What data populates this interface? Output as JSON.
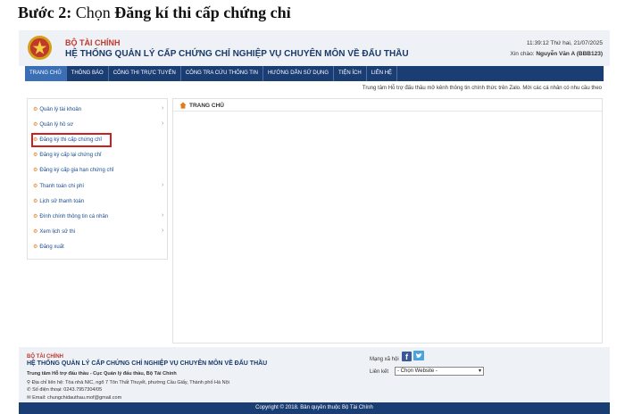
{
  "step": {
    "prefix": "Bước 2:",
    "middle": " Chọn ",
    "bold": "Đăng kí thi cấp chứng chỉ"
  },
  "header": {
    "org": "BỘ TÀI CHÍNH",
    "title": "HỆ THỐNG QUẢN LÝ CẤP CHỨNG CHỈ NGHIỆP VỤ CHUYÊN MÔN VỀ ĐẤU THẦU",
    "datetime": "11:39:12 Thứ hai, 21/07/2025",
    "greeting_prefix": "Xin chào: ",
    "user": "Nguyễn Văn A (BBB123)"
  },
  "nav": [
    "TRANG CHỦ",
    "THÔNG BÁO",
    "CÔNG THI TRỰC TUYẾN",
    "CÔNG TRA CỨU THÔNG TIN",
    "HƯỚNG DẪN SỬ DỤNG",
    "TIỆN ÍCH",
    "LIÊN HỆ"
  ],
  "marquee": "Trung tâm Hỗ trợ đấu thầu mở kênh thông tin chính thức trên Zalo. Mời các cá nhân có nhu cầu theo",
  "sidebar": {
    "items": [
      "Quản lý tài khoản",
      "Quản lý hồ sơ",
      "Đăng ký thi cấp chứng chỉ",
      "Đăng ký cấp lại chứng chỉ",
      "Đăng ký cấp gia hạn chứng chỉ",
      "Thanh toán chi phí",
      "Lịch sử thanh toán",
      "Đính chính thông tin cá nhân",
      "Xem lịch sử thi",
      "Đăng xuất"
    ],
    "chevron": "›",
    "bullet": "⚙"
  },
  "main": {
    "title": "TRANG CHỦ"
  },
  "footer": {
    "org": "BỘ TÀI CHÍNH",
    "title": "HỆ THỐNG QUẢN LÝ CẤP CHỨNG CHỈ NGHIỆP VỤ CHUYÊN MÔN VỀ ĐẤU THẦU",
    "center": "Trung tâm Hỗ trợ đấu thầu - Cục Quản lý đấu thầu, Bộ Tài Chính",
    "address": "Địa chỉ liên hệ: Tòa nhà NIC, ngõ 7 Tôn Thất Thuyết, phường Cầu Giấy, Thành phố Hà Nội",
    "phone": "Số điện thoại: 0243.7957304/05",
    "email": "Email: chungchidauthau.mof@gmail.com",
    "social_label": "Mạng xã hội",
    "fb_glyph": "f",
    "link_label": "Liên kết",
    "website_select": "- Chọn Website -",
    "copyright": "Copyright © 2018. Bản quyền thuộc Bộ Tài Chính"
  },
  "colors": {
    "nav_bg": "#1a3d73",
    "nav_active": "#3a6fb5",
    "highlight": "#cc1f1f",
    "org_red": "#c0392b"
  }
}
